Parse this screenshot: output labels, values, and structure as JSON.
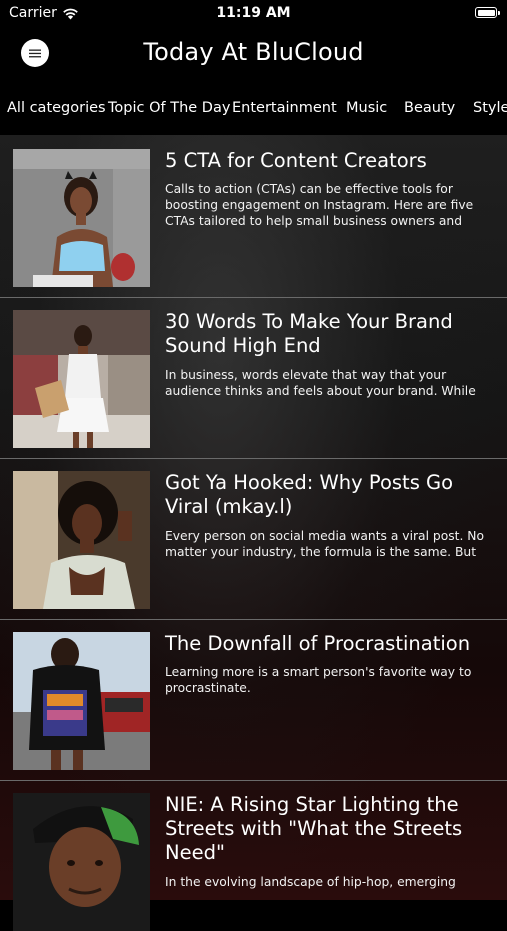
{
  "status_bar": {
    "carrier": "Carrier",
    "time": "11:19 AM",
    "wifi_icon": "wifi-icon",
    "battery_icon": "battery-icon"
  },
  "header": {
    "title": "Today At BluCloud",
    "menu_icon": "hamburger-menu-icon"
  },
  "tabs": [
    {
      "label": "All categories"
    },
    {
      "label": "Topic Of The Day"
    },
    {
      "label": "Entertainment"
    },
    {
      "label": "Music"
    },
    {
      "label": "Beauty"
    },
    {
      "label": "Style"
    }
  ],
  "articles": [
    {
      "title": "5 CTA for Content Creators",
      "description": "Calls to action (CTAs) can be effective tools for boosting engagement on Instagram. Here are five CTAs tailored to help small business owners and con..."
    },
    {
      "title": "30 Words To Make Your Brand Sound High End",
      "description": "In business, words elevate that way that your audience thinks and feels about your brand. While y..."
    },
    {
      "title": "Got Ya Hooked: Why Posts Go Viral (mkay.l)",
      "description": "Every person on social media wants a viral post. No matter your industry, the formula is the same. But t..."
    },
    {
      "title": "The Downfall of Procrastination",
      "description": "Learning more is a smart person's favorite way to procrastinate."
    },
    {
      "title": "NIE: A Rising Star Lighting the Streets with \"What the Streets Need\"",
      "description": "In the evolving landscape of hip-hop, emerging artist..."
    }
  ],
  "colors": {
    "background": "#000000",
    "divider": "#6a6a6a",
    "text": "#ffffff"
  }
}
